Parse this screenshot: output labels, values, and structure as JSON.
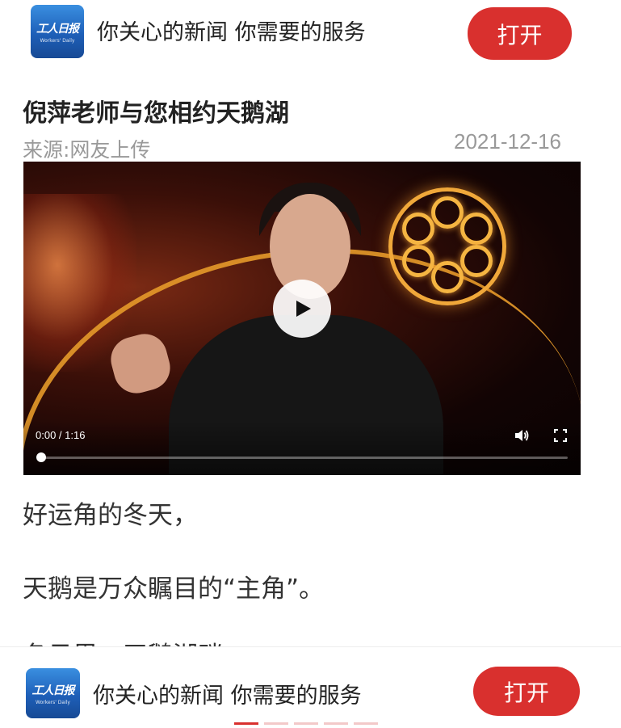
{
  "app_banner": {
    "logo_text": "工人日报",
    "logo_sub": "Workers' Daily",
    "slogan": "你关心的新闻 你需要的服务",
    "open_label": "打开"
  },
  "article": {
    "title": "倪萍老师与您相约天鹅湖",
    "source": "来源:网友上传",
    "date": "2021-12-16",
    "paragraphs": [
      "好运角的冬天，",
      "天鹅是万众瞩目的“主角”。",
      "冬日里，天鹅湖畔..."
    ]
  },
  "video": {
    "time": "0:00 / 1:16",
    "progress": 0
  },
  "pager": {
    "total": 5,
    "active": 1
  }
}
